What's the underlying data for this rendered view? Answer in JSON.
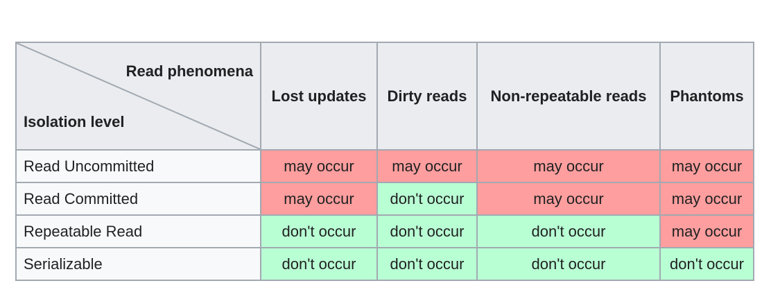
{
  "table": {
    "corner": {
      "top_label": "Read phenomena",
      "bottom_label": "Isolation level"
    },
    "columns": [
      "Lost updates",
      "Dirty reads",
      "Non-repeatable reads",
      "Phantoms"
    ],
    "rows": [
      {
        "label": "Read Uncommitted",
        "cells": [
          {
            "text": "may occur",
            "status": "bad"
          },
          {
            "text": "may occur",
            "status": "bad"
          },
          {
            "text": "may occur",
            "status": "bad"
          },
          {
            "text": "may occur",
            "status": "bad"
          }
        ]
      },
      {
        "label": "Read Committed",
        "cells": [
          {
            "text": "may occur",
            "status": "bad"
          },
          {
            "text": "don't occur",
            "status": "good"
          },
          {
            "text": "may occur",
            "status": "bad"
          },
          {
            "text": "may occur",
            "status": "bad"
          }
        ]
      },
      {
        "label": "Repeatable Read",
        "cells": [
          {
            "text": "don't occur",
            "status": "good"
          },
          {
            "text": "don't occur",
            "status": "good"
          },
          {
            "text": "don't occur",
            "status": "good"
          },
          {
            "text": "may occur",
            "status": "bad"
          }
        ]
      },
      {
        "label": "Serializable",
        "cells": [
          {
            "text": "don't occur",
            "status": "good"
          },
          {
            "text": "don't occur",
            "status": "good"
          },
          {
            "text": "don't occur",
            "status": "good"
          },
          {
            "text": "don't occur",
            "status": "good"
          }
        ]
      }
    ],
    "colors": {
      "bad": "#ff9e9e",
      "good": "#b9ffd4",
      "header_bg": "#eaecf0",
      "row_header_bg": "#f8f9fa",
      "border": "#a2a9b1"
    }
  }
}
